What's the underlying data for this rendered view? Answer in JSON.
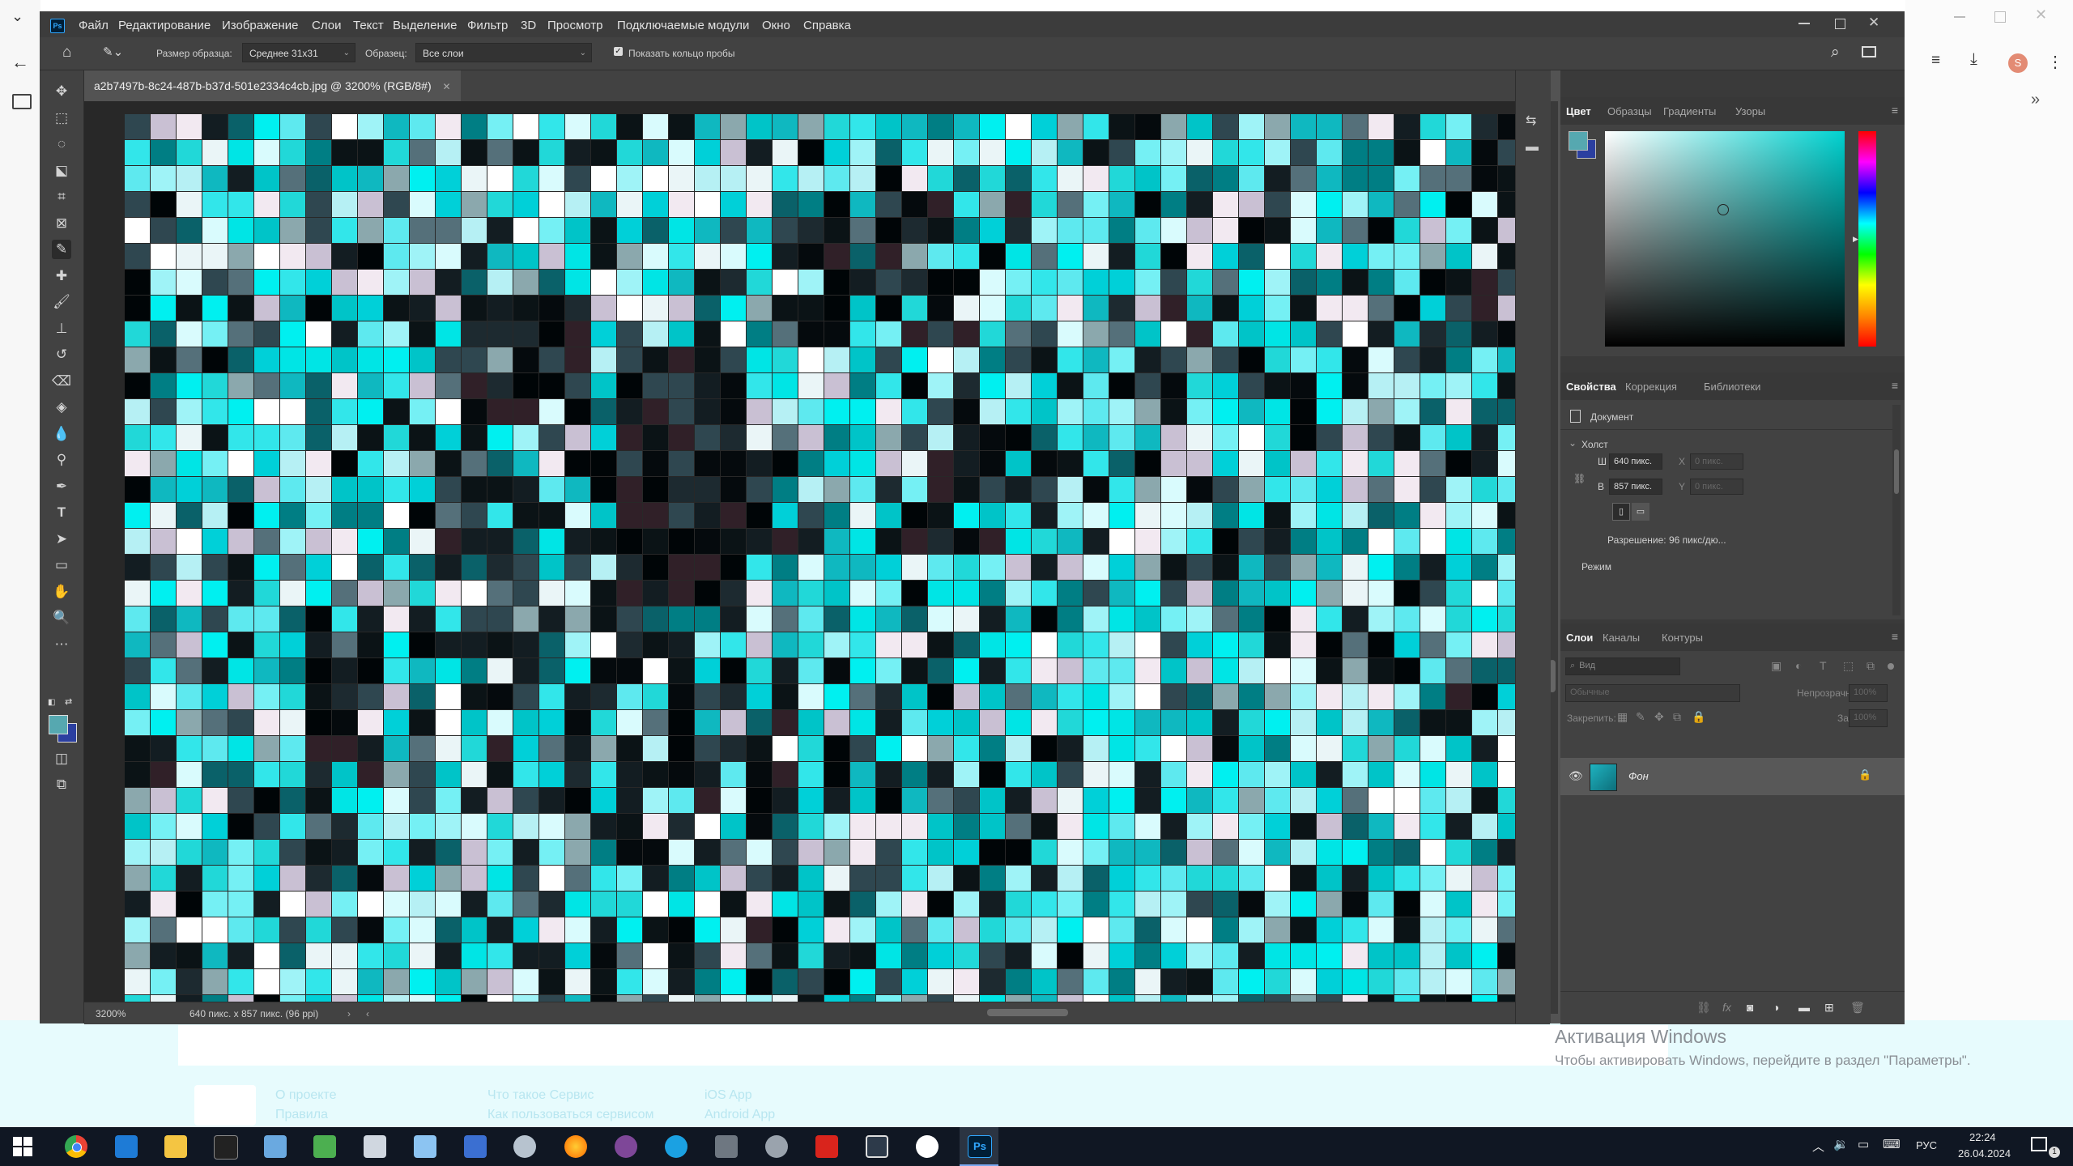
{
  "browser": {
    "left_icons": [
      "chevron-down",
      "back-arrow",
      "folder"
    ],
    "right_icons": [
      "minimize",
      "maximize",
      "close",
      "more-vertical"
    ],
    "toolbar_icons": [
      "reading-list",
      "downloads",
      "profile",
      "more-vertical"
    ],
    "profile_initial": "S"
  },
  "ps": {
    "logo": "Ps",
    "menu": [
      "Файл",
      "Редактирование",
      "Изображение",
      "Слои",
      "Текст",
      "Выделение",
      "Фильтр",
      "3D",
      "Просмотр",
      "Подключаемые модули",
      "Окно",
      "Справка"
    ],
    "options": {
      "sample_size_label": "Размер образца:",
      "sample_size_value": "Среднее 31x31",
      "sample_label": "Образец:",
      "sample_value": "Все слои",
      "show_ring_label": "Показать кольцо пробы",
      "show_ring_checked": true
    },
    "doc_tab": "a2b7497b-8c24-487b-b37d-501e2334c4cb.jpg @ 3200% (RGB/8#)",
    "status": {
      "zoom": "3200%",
      "doc_info": "640 пикс. x 857 пикс. (96 ppi)"
    },
    "colors": {
      "foreground": "#56a8b0",
      "background": "#2b3fa0"
    }
  },
  "panels": {
    "color": {
      "tabs": [
        "Цвет",
        "Образцы",
        "Градиенты",
        "Узоры"
      ],
      "hue_hex": "#00d2d0"
    },
    "properties": {
      "tabs": [
        "Свойства",
        "Коррекция",
        "Библиотеки"
      ],
      "doc_label": "Документ",
      "canvas_label": "Холст",
      "w_label": "Ш",
      "w_value": "640 пикс.",
      "h_label": "В",
      "h_value": "857 пикс.",
      "x_label": "X",
      "x_value": "0 пикс.",
      "y_label": "Y",
      "y_value": "0 пикс.",
      "resolution": "Разрешение: 96 пикс/дю...",
      "mode_label": "Режим"
    },
    "layers": {
      "tabs": [
        "Слои",
        "Каналы",
        "Контуры"
      ],
      "search_placeholder": "Вид",
      "blend_mode": "Обычные",
      "opacity_label": "Непрозрачность:",
      "opacity_value": "100%",
      "lock_label": "Закрепить:",
      "fill_label": "Заливка:",
      "fill_value": "100%",
      "layer_name": "Фон"
    }
  },
  "footer": {
    "links": [
      "О проекте",
      "Правила",
      "Что такое Сервис",
      "Как пользоваться сервисом",
      "iOS App",
      "Android App"
    ]
  },
  "activation": {
    "title": "Активация Windows",
    "subtitle": "Чтобы активировать Windows, перейдите в раздел \"Параметры\"."
  },
  "taskbar": {
    "apps": [
      "windows-start",
      "chrome",
      "chat-app",
      "file-explorer",
      "terminal",
      "mail",
      "paint",
      "notepad",
      "paint3d",
      "bluetooth-app",
      "media",
      "firefox",
      "tor-browser",
      "edge",
      "calculator",
      "settings",
      "acrobat",
      "explorer-window",
      "ccleaner",
      "photoshop"
    ],
    "lang": "РУС",
    "time": "22:24",
    "date": "26.04.2024",
    "notification_count": "1"
  }
}
